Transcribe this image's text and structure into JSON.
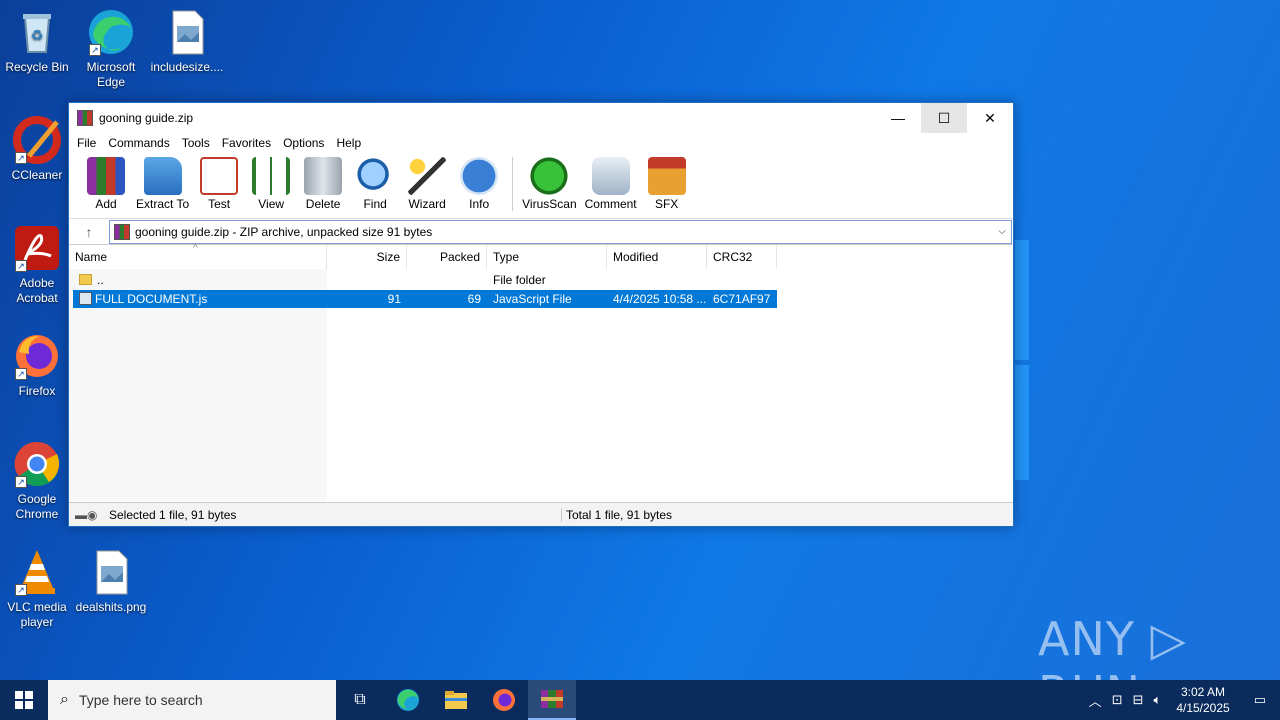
{
  "desktop": {
    "icons": [
      {
        "label": "Recycle Bin"
      },
      {
        "label": "Microsoft Edge"
      },
      {
        "label": "includesize...."
      },
      {
        "label": "CCleaner"
      },
      {
        "label": "Adobe Acrobat"
      },
      {
        "label": "Firefox"
      },
      {
        "label": "Google Chrome"
      },
      {
        "label": "VLC media player"
      },
      {
        "label": "dealshits.png"
      }
    ],
    "watermark": "ANY ▷ RUN"
  },
  "window": {
    "title": "gooning guide.zip",
    "controls": {
      "minimize": "—",
      "maximize": "☐",
      "close": "✕"
    },
    "menu": [
      "File",
      "Commands",
      "Tools",
      "Favorites",
      "Options",
      "Help"
    ],
    "toolbar": [
      {
        "label": "Add",
        "icon": "add-icon"
      },
      {
        "label": "Extract To",
        "icon": "extract-icon"
      },
      {
        "label": "Test",
        "icon": "test-icon"
      },
      {
        "label": "View",
        "icon": "view-icon"
      },
      {
        "label": "Delete",
        "icon": "delete-icon"
      },
      {
        "label": "Find",
        "icon": "find-icon"
      },
      {
        "label": "Wizard",
        "icon": "wizard-icon"
      },
      {
        "label": "Info",
        "icon": "info-icon"
      },
      {
        "label": "VirusScan",
        "icon": "virusscan-icon"
      },
      {
        "label": "Comment",
        "icon": "comment-icon"
      },
      {
        "label": "SFX",
        "icon": "sfx-icon"
      }
    ],
    "address": "gooning guide.zip - ZIP archive, unpacked size 91 bytes",
    "columns": [
      "Name",
      "Size",
      "Packed",
      "Type",
      "Modified",
      "CRC32"
    ],
    "rows": [
      {
        "name": "..",
        "size": "",
        "packed": "",
        "type": "File folder",
        "modified": "",
        "crc": ""
      },
      {
        "name": "FULL DOCUMENT.js",
        "size": "91",
        "packed": "69",
        "type": "JavaScript File",
        "modified": "4/4/2025 10:58 ...",
        "crc": "6C71AF97"
      }
    ],
    "status_left": "Selected 1 file, 91 bytes",
    "status_right": "Total 1 file, 91 bytes"
  },
  "taskbar": {
    "search_placeholder": "Type here to search",
    "time": "3:02 AM",
    "date": "4/15/2025"
  }
}
